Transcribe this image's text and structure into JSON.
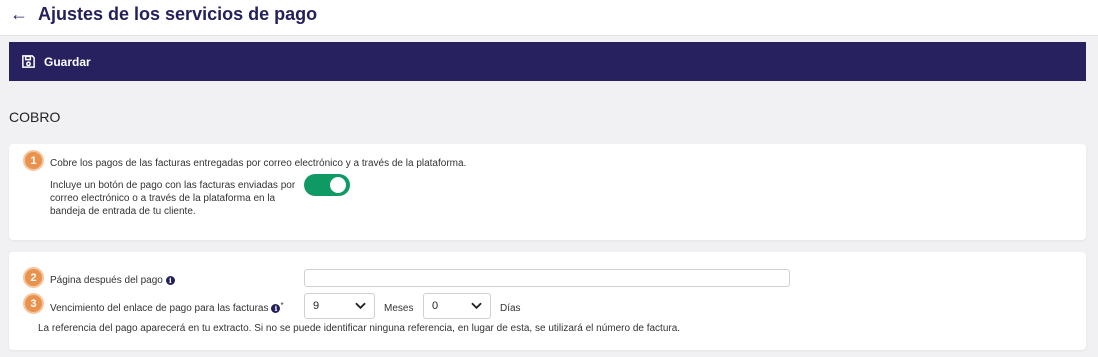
{
  "header": {
    "title": "Ajustes de los servicios de pago"
  },
  "toolbar": {
    "save_label": "Guardar"
  },
  "section": {
    "title": "COBRO"
  },
  "card1": {
    "badge": "1",
    "heading": "Cobre los pagos de las facturas entregadas por correo electrónico y a través de la plataforma.",
    "description_lines": [
      "Incluye un botón de pago con las facturas enviadas por",
      "correo electrónico o a través de la plataforma en la",
      "bandeja de entrada de tu cliente."
    ],
    "toggle_on": true
  },
  "card2": {
    "badge2": "2",
    "page_after_label": "Página después del pago",
    "page_after_value": "",
    "badge3": "3",
    "expiry_label": "Vencimiento del enlace de pago para las facturas",
    "required_mark": "*",
    "months_value": "9",
    "months_label": "Meses",
    "days_value": "0",
    "days_label": "Días",
    "note": "La referencia del pago aparecerá en tu extracto. Si no se puede identificar ninguna referencia, en lugar de esta, se utilizará el número de factura."
  },
  "icons": {
    "info": "i"
  },
  "colors": {
    "primary": "#27225f",
    "toggle": "#0f9a64",
    "badge": "#e8924e"
  }
}
